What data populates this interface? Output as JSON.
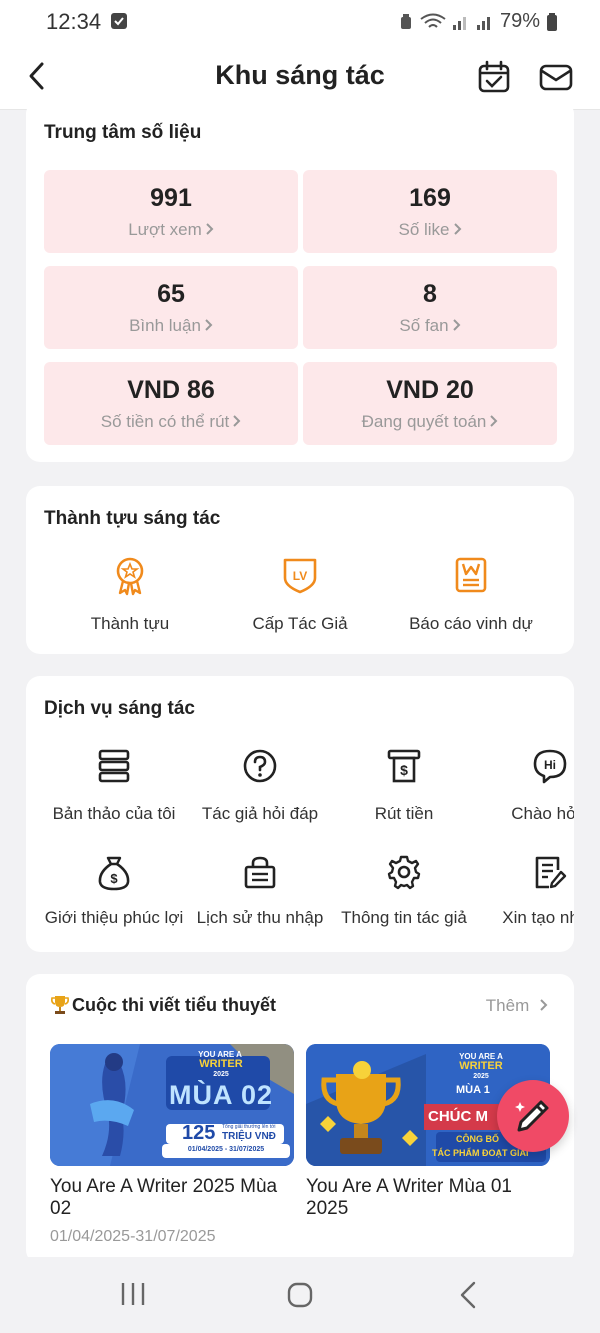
{
  "status": {
    "time": "12:34",
    "battery": "79%"
  },
  "header": {
    "title": "Khu sáng tác"
  },
  "data_center": {
    "title": "Trung tâm số liệu",
    "stats": [
      {
        "value": "991",
        "label": "Lượt xem"
      },
      {
        "value": "169",
        "label": "Số like"
      },
      {
        "value": "65",
        "label": "Bình luận"
      },
      {
        "value": "8",
        "label": "Số fan"
      },
      {
        "value": "VND 86",
        "label": "Số tiền có thể rút"
      },
      {
        "value": "VND 20",
        "label": "Đang quyết toán"
      }
    ]
  },
  "achievements": {
    "title": "Thành tựu sáng tác",
    "items": [
      {
        "label": "Thành tựu",
        "icon": "medal-icon"
      },
      {
        "label": "Cấp Tác Giả",
        "icon": "level-badge-icon"
      },
      {
        "label": "Báo cáo vinh dự",
        "icon": "honor-report-icon"
      }
    ]
  },
  "services": {
    "title": "Dịch vụ sáng tác",
    "items": [
      {
        "label": "Bản thảo của tôi",
        "icon": "drafts-stack-icon"
      },
      {
        "label": "Tác giả hỏi đáp",
        "icon": "question-icon"
      },
      {
        "label": "Rút tiền",
        "icon": "withdraw-icon"
      },
      {
        "label": "Chào hỏi t",
        "icon": "hi-chat-icon"
      },
      {
        "label": "Giới thiệu phúc lợi",
        "icon": "money-bag-icon"
      },
      {
        "label": "Lịch sử thu nhập",
        "icon": "income-history-icon"
      },
      {
        "label": "Thông tin tác giả",
        "icon": "gear-icon"
      },
      {
        "label": "Xin tạo nhón",
        "icon": "edit-document-icon"
      }
    ]
  },
  "contest": {
    "title": "Cuộc thi viết tiểu thuyết",
    "more": "Thêm",
    "items": [
      {
        "name": "You Are A Writer 2025 Mùa 02",
        "date": "01/04/2025-31/07/2025",
        "banner": {
          "tag_top": "YOU ARE A",
          "tag_main": "WRITER",
          "tag_year": "2025",
          "headline": "MÙA 02",
          "prize_num": "125",
          "prize_small": "Tổng giải thưởng lên tới",
          "prize_unit": "TRIỆU VNĐ",
          "dates": "01/04/2025 - 31/07/2025"
        }
      },
      {
        "name": "You Are A Writer Mùa 01 2025",
        "date": "",
        "banner": {
          "tag_top": "YOU ARE A",
          "tag_main": "WRITER",
          "tag_year": "2025",
          "headline": "MÙA 1",
          "ribbon": "CHÚC M",
          "line1": "CÔNG BỐ",
          "line2": "TÁC PHẨM ĐOẠT GIẢI"
        }
      }
    ]
  },
  "colors": {
    "accent": "#f04a66",
    "orange": "#f08a1c",
    "stat_bg": "#fde8ea"
  }
}
